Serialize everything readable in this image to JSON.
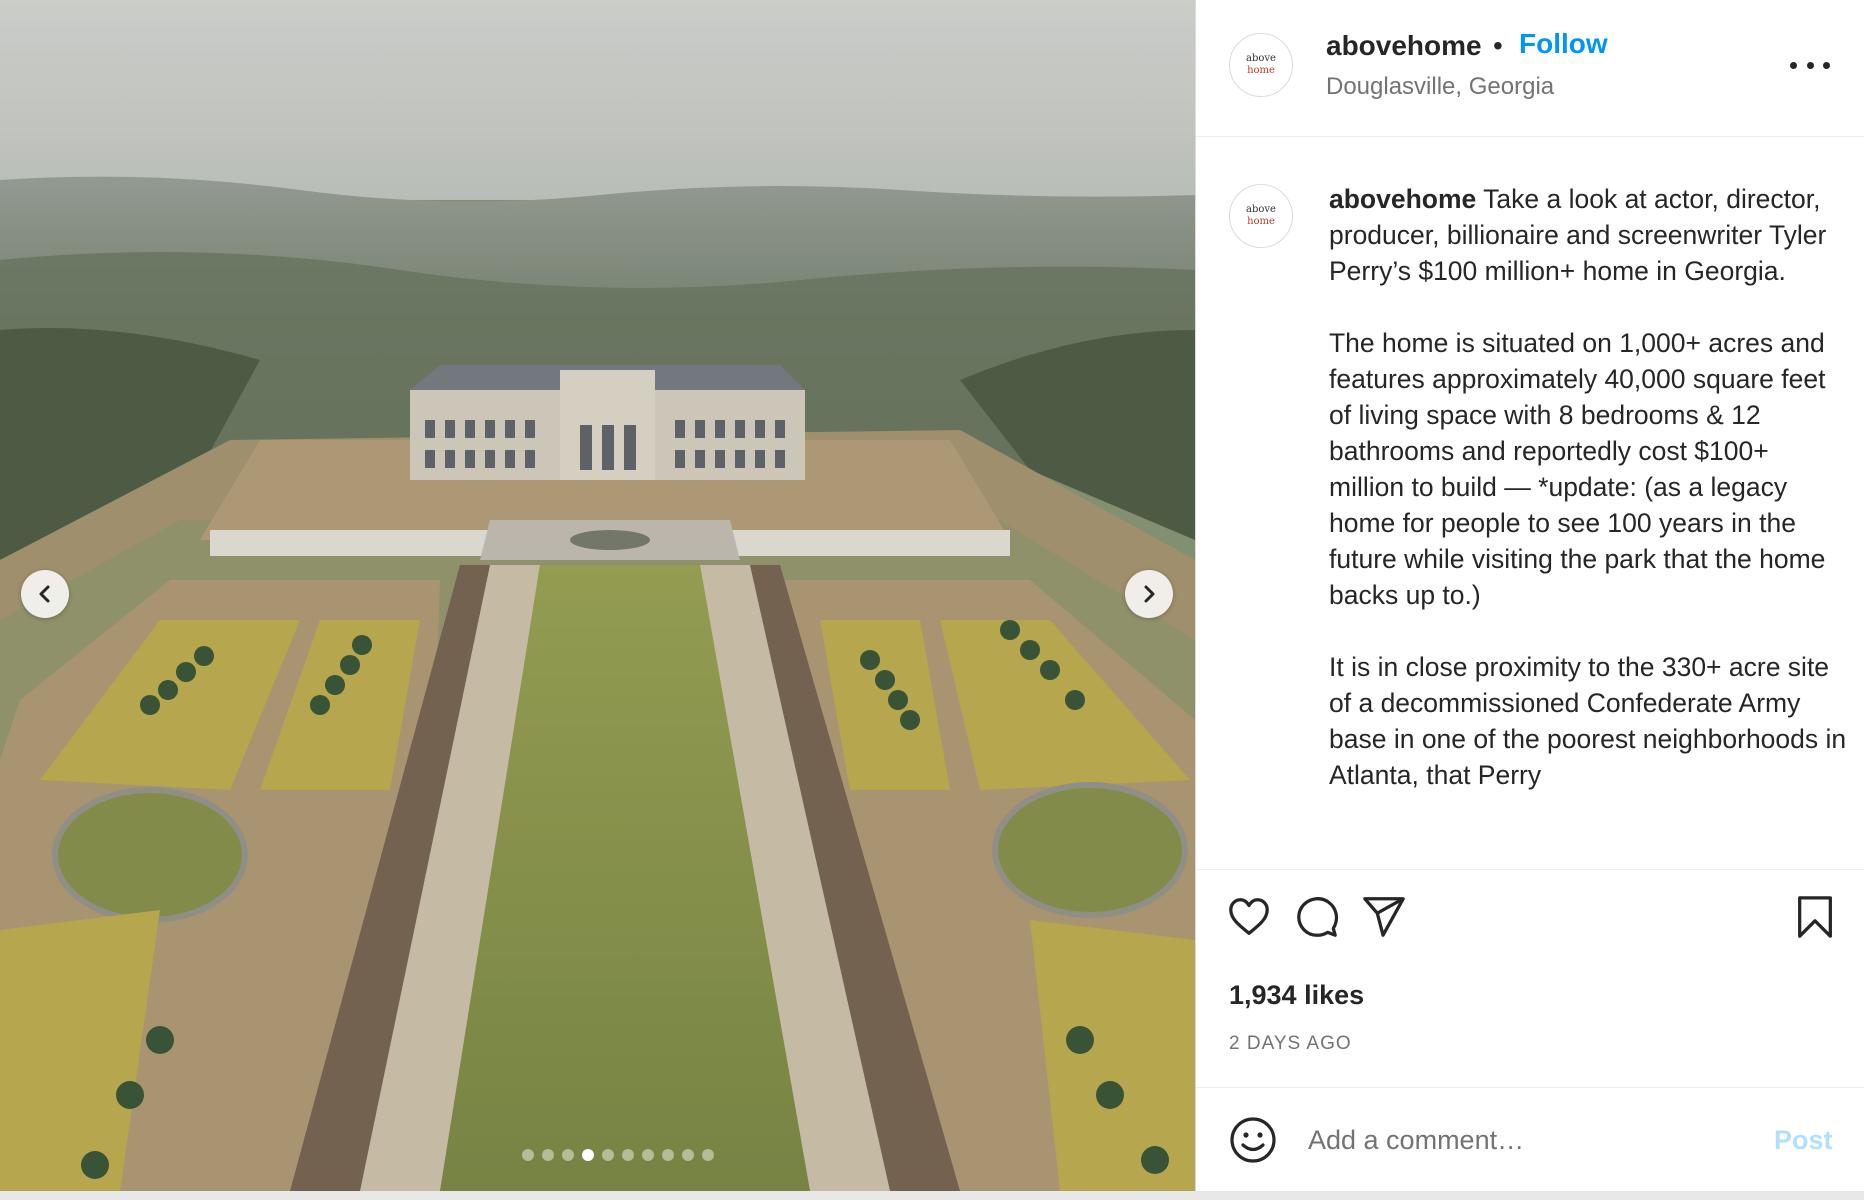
{
  "media": {
    "image_description_icon": "aerial-estate-photo",
    "prev_icon": "chevron-left-icon",
    "next_icon": "chevron-right-icon",
    "carousel": {
      "count": 10,
      "active_index": 3
    }
  },
  "header": {
    "avatar_text_1": "above",
    "avatar_text_2": "home",
    "username": "abovehome",
    "separator": "•",
    "follow_label": "Follow",
    "location": "Douglasville, Georgia"
  },
  "caption": {
    "username": "abovehome",
    "paragraph_1": "Take a look at actor, director, producer, billionaire and screenwriter Tyler Perry’s $100 million+ home in Georgia.",
    "paragraph_2": "The home is situated on 1,000+ acres and features approximately 40,000 square feet of living space with 8 bedrooms & 12 bathrooms and reportedly cost $100+ million to build — *update: (as a legacy home for people to see 100 years in the future while visiting the park that the home backs up to.)",
    "paragraph_3": "It is in close proximity to the 330+ acre site of a decommissioned Confederate Army base in one of the poorest neighborhoods in Atlanta, that Perry"
  },
  "actions": {
    "likes": "1,934 likes",
    "time": "2 DAYS AGO"
  },
  "comment": {
    "placeholder": "Add a comment…",
    "post_label": "Post"
  },
  "colors": {
    "accent": "#0095f6",
    "post_disabled": "#b2dffc",
    "text": "#262626",
    "muted": "#737373"
  }
}
